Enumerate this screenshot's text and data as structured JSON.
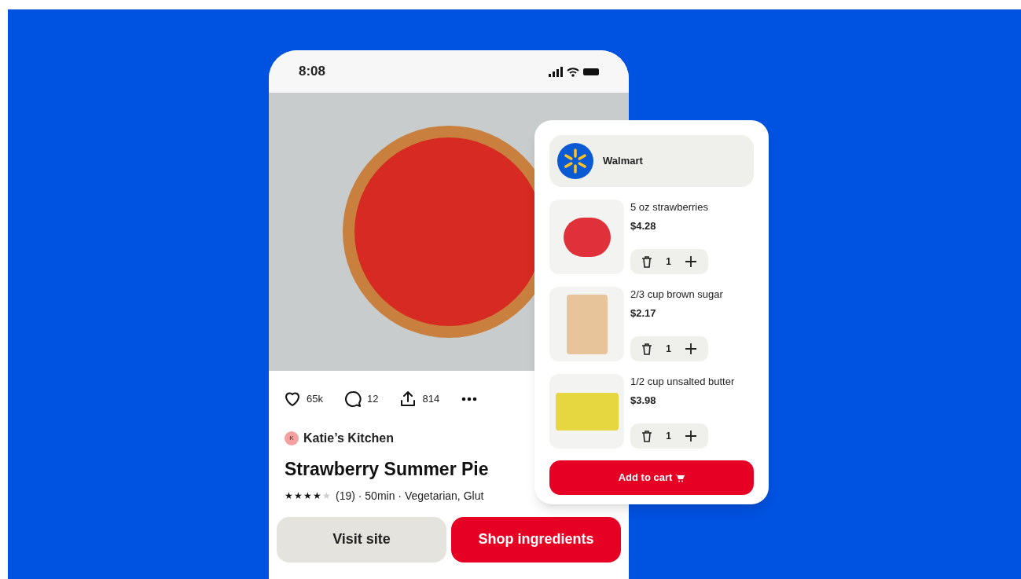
{
  "status_bar": {
    "time": "8:08"
  },
  "pin": {
    "actions": [
      {
        "kind": "like",
        "count": "65k"
      },
      {
        "kind": "comment",
        "count": "12"
      },
      {
        "kind": "share",
        "count": "814"
      },
      {
        "kind": "more"
      }
    ],
    "author": {
      "initial": "K",
      "name": "Katie’s Kitchen"
    },
    "title": "Strawberry Summer Pie",
    "stars": 4,
    "meta": "(19) · 50min · Vegetarian, Glut",
    "buttons": [
      {
        "label": "Visit site",
        "kind": "secondary"
      },
      {
        "label": "Shop ingredients",
        "kind": "primary"
      }
    ]
  },
  "cart": {
    "store": "Walmart",
    "items": [
      {
        "name": "5 oz strawberries",
        "price": "$4.28",
        "quantity": "1",
        "kind": "strawberries"
      },
      {
        "name": "2/3 cup brown sugar",
        "price": "$2.17",
        "quantity": "1",
        "kind": "sugar"
      },
      {
        "name": "1/2 cup unsalted butter",
        "price": "$3.98",
        "quantity": "1",
        "kind": "butter"
      }
    ],
    "button": "Add to cart"
  }
}
